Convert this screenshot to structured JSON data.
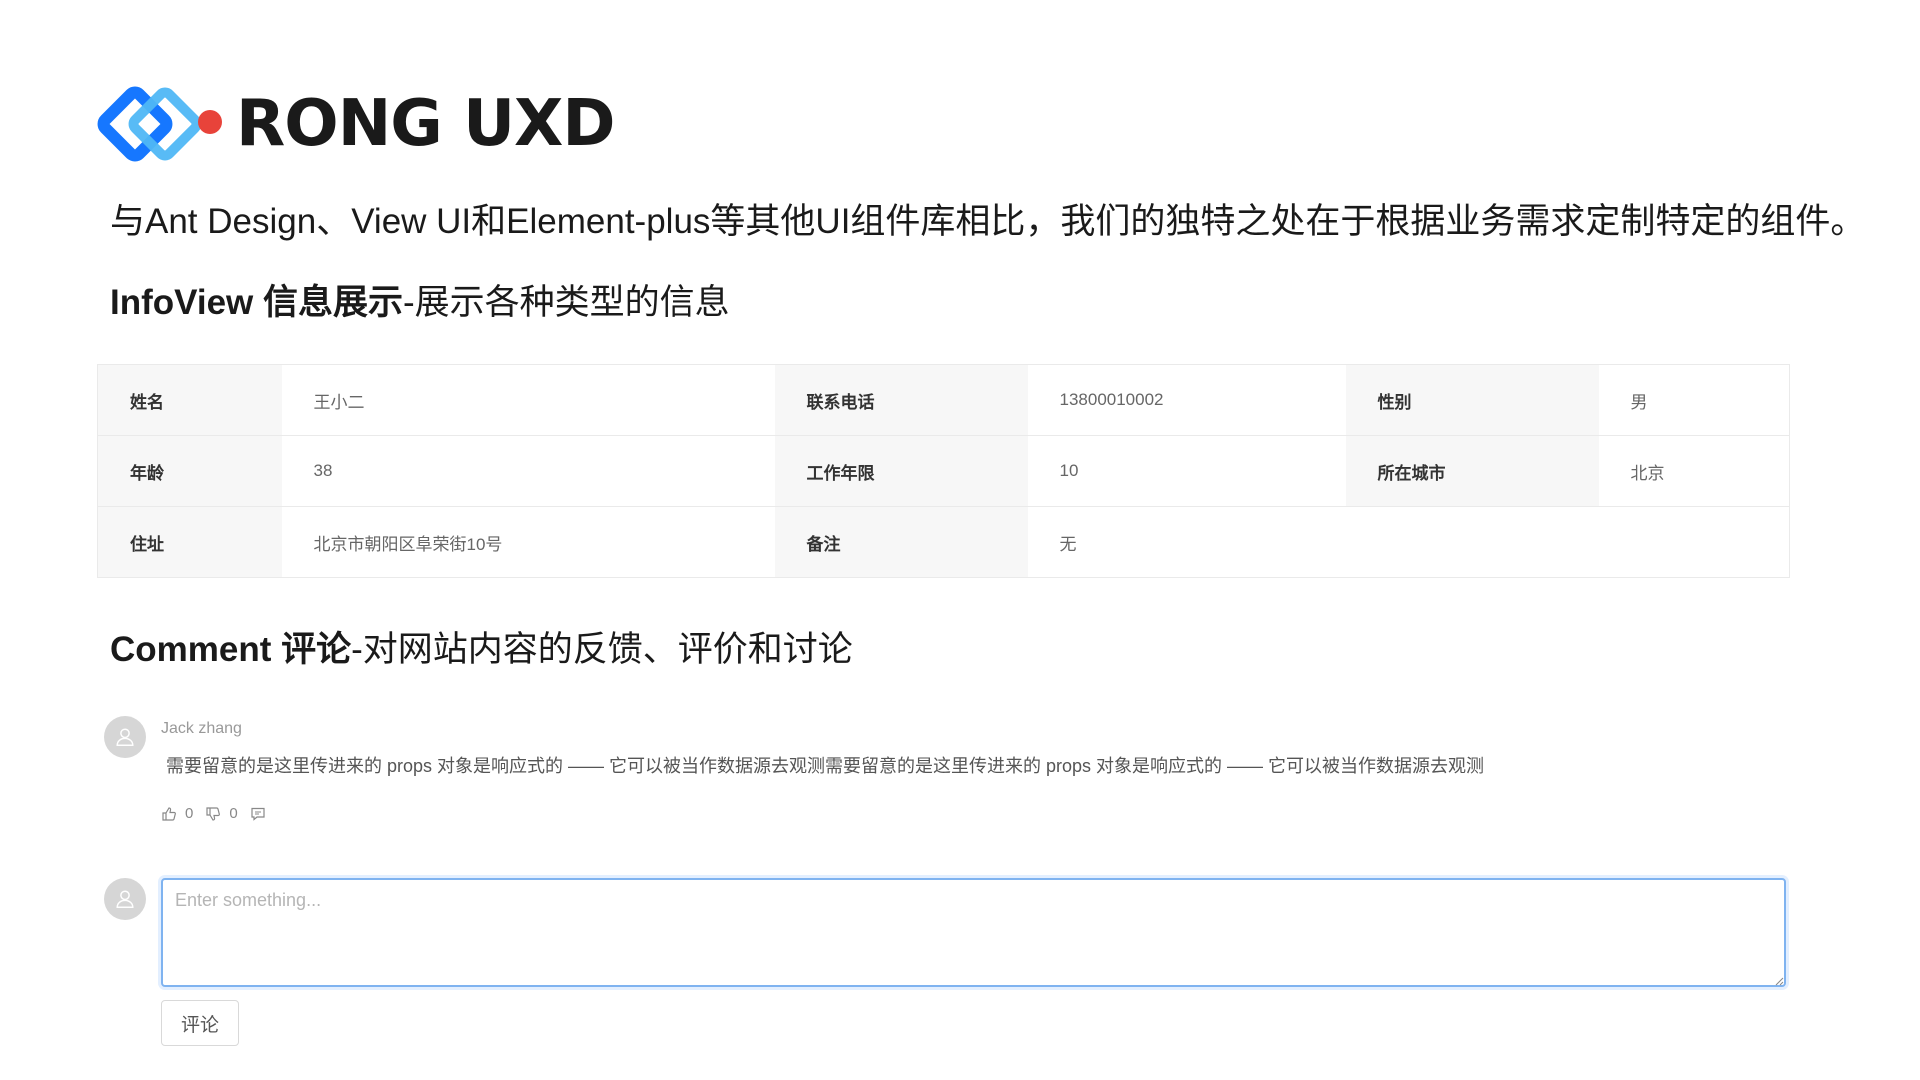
{
  "logo": {
    "text": "RONG UXD",
    "colors": {
      "primary": "#1677ff",
      "secondary": "#4fb7f5",
      "dot": "#e8433a"
    }
  },
  "intro": "与Ant Design、View UI和Element-plus等其他UI组件库相比，我们的独特之处在于根据业务需求定制特定的组件。",
  "infoview": {
    "title": "InfoView 信息展示",
    "desc": "-展示各种类型的信息",
    "rows": [
      [
        {
          "key": "姓名",
          "value": "王小二"
        },
        {
          "key": "联系电话",
          "value": "13800010002"
        },
        {
          "key": "性别",
          "value": "男"
        }
      ],
      [
        {
          "key": "年龄",
          "value": "38"
        },
        {
          "key": "工作年限",
          "value": "10"
        },
        {
          "key": "所在城市",
          "value": "北京"
        }
      ],
      [
        {
          "key": "住址",
          "value": "北京市朝阳区阜荣街10号"
        },
        {
          "key": "备注",
          "value": "无"
        }
      ]
    ]
  },
  "comment": {
    "title": "Comment 评论",
    "desc": "-对网站内容的反馈、评价和讨论",
    "item": {
      "author": "Jack zhang",
      "content": "需要留意的是这里传进来的 props 对象是响应式的 —— 它可以被当作数据源去观测需要留意的是这里传进来的 props 对象是响应式的 —— 它可以被当作数据源去观测",
      "likes": "0",
      "dislikes": "0"
    },
    "input": {
      "placeholder": "Enter something...",
      "value": ""
    },
    "submit_label": "评论"
  }
}
